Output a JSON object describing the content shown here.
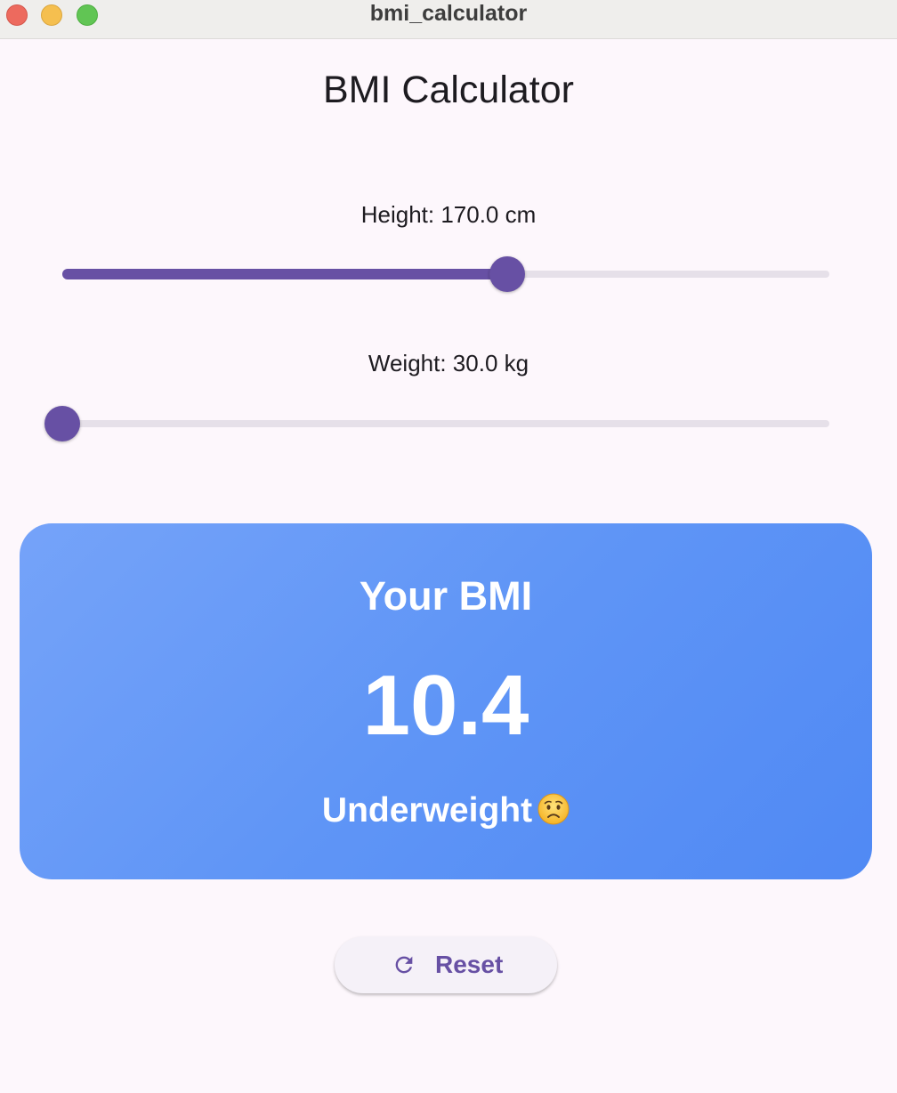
{
  "window": {
    "title": "bmi_calculator"
  },
  "app": {
    "title": "BMI Calculator"
  },
  "height_slider": {
    "label": "Height: 170.0 cm",
    "fraction": 0.58
  },
  "weight_slider": {
    "label": "Weight: 30.0 kg",
    "fraction": 0.0
  },
  "result": {
    "heading": "Your BMI",
    "value": "10.4",
    "category": "Underweight"
  },
  "reset_button": {
    "label": "Reset"
  },
  "icons": {
    "category_emoji": "worried-face-icon",
    "reset": "refresh-icon"
  },
  "colors": {
    "accent": "#6750a4",
    "card_gradient_start": "#75a3f9",
    "card_gradient_end": "#5089f4"
  }
}
